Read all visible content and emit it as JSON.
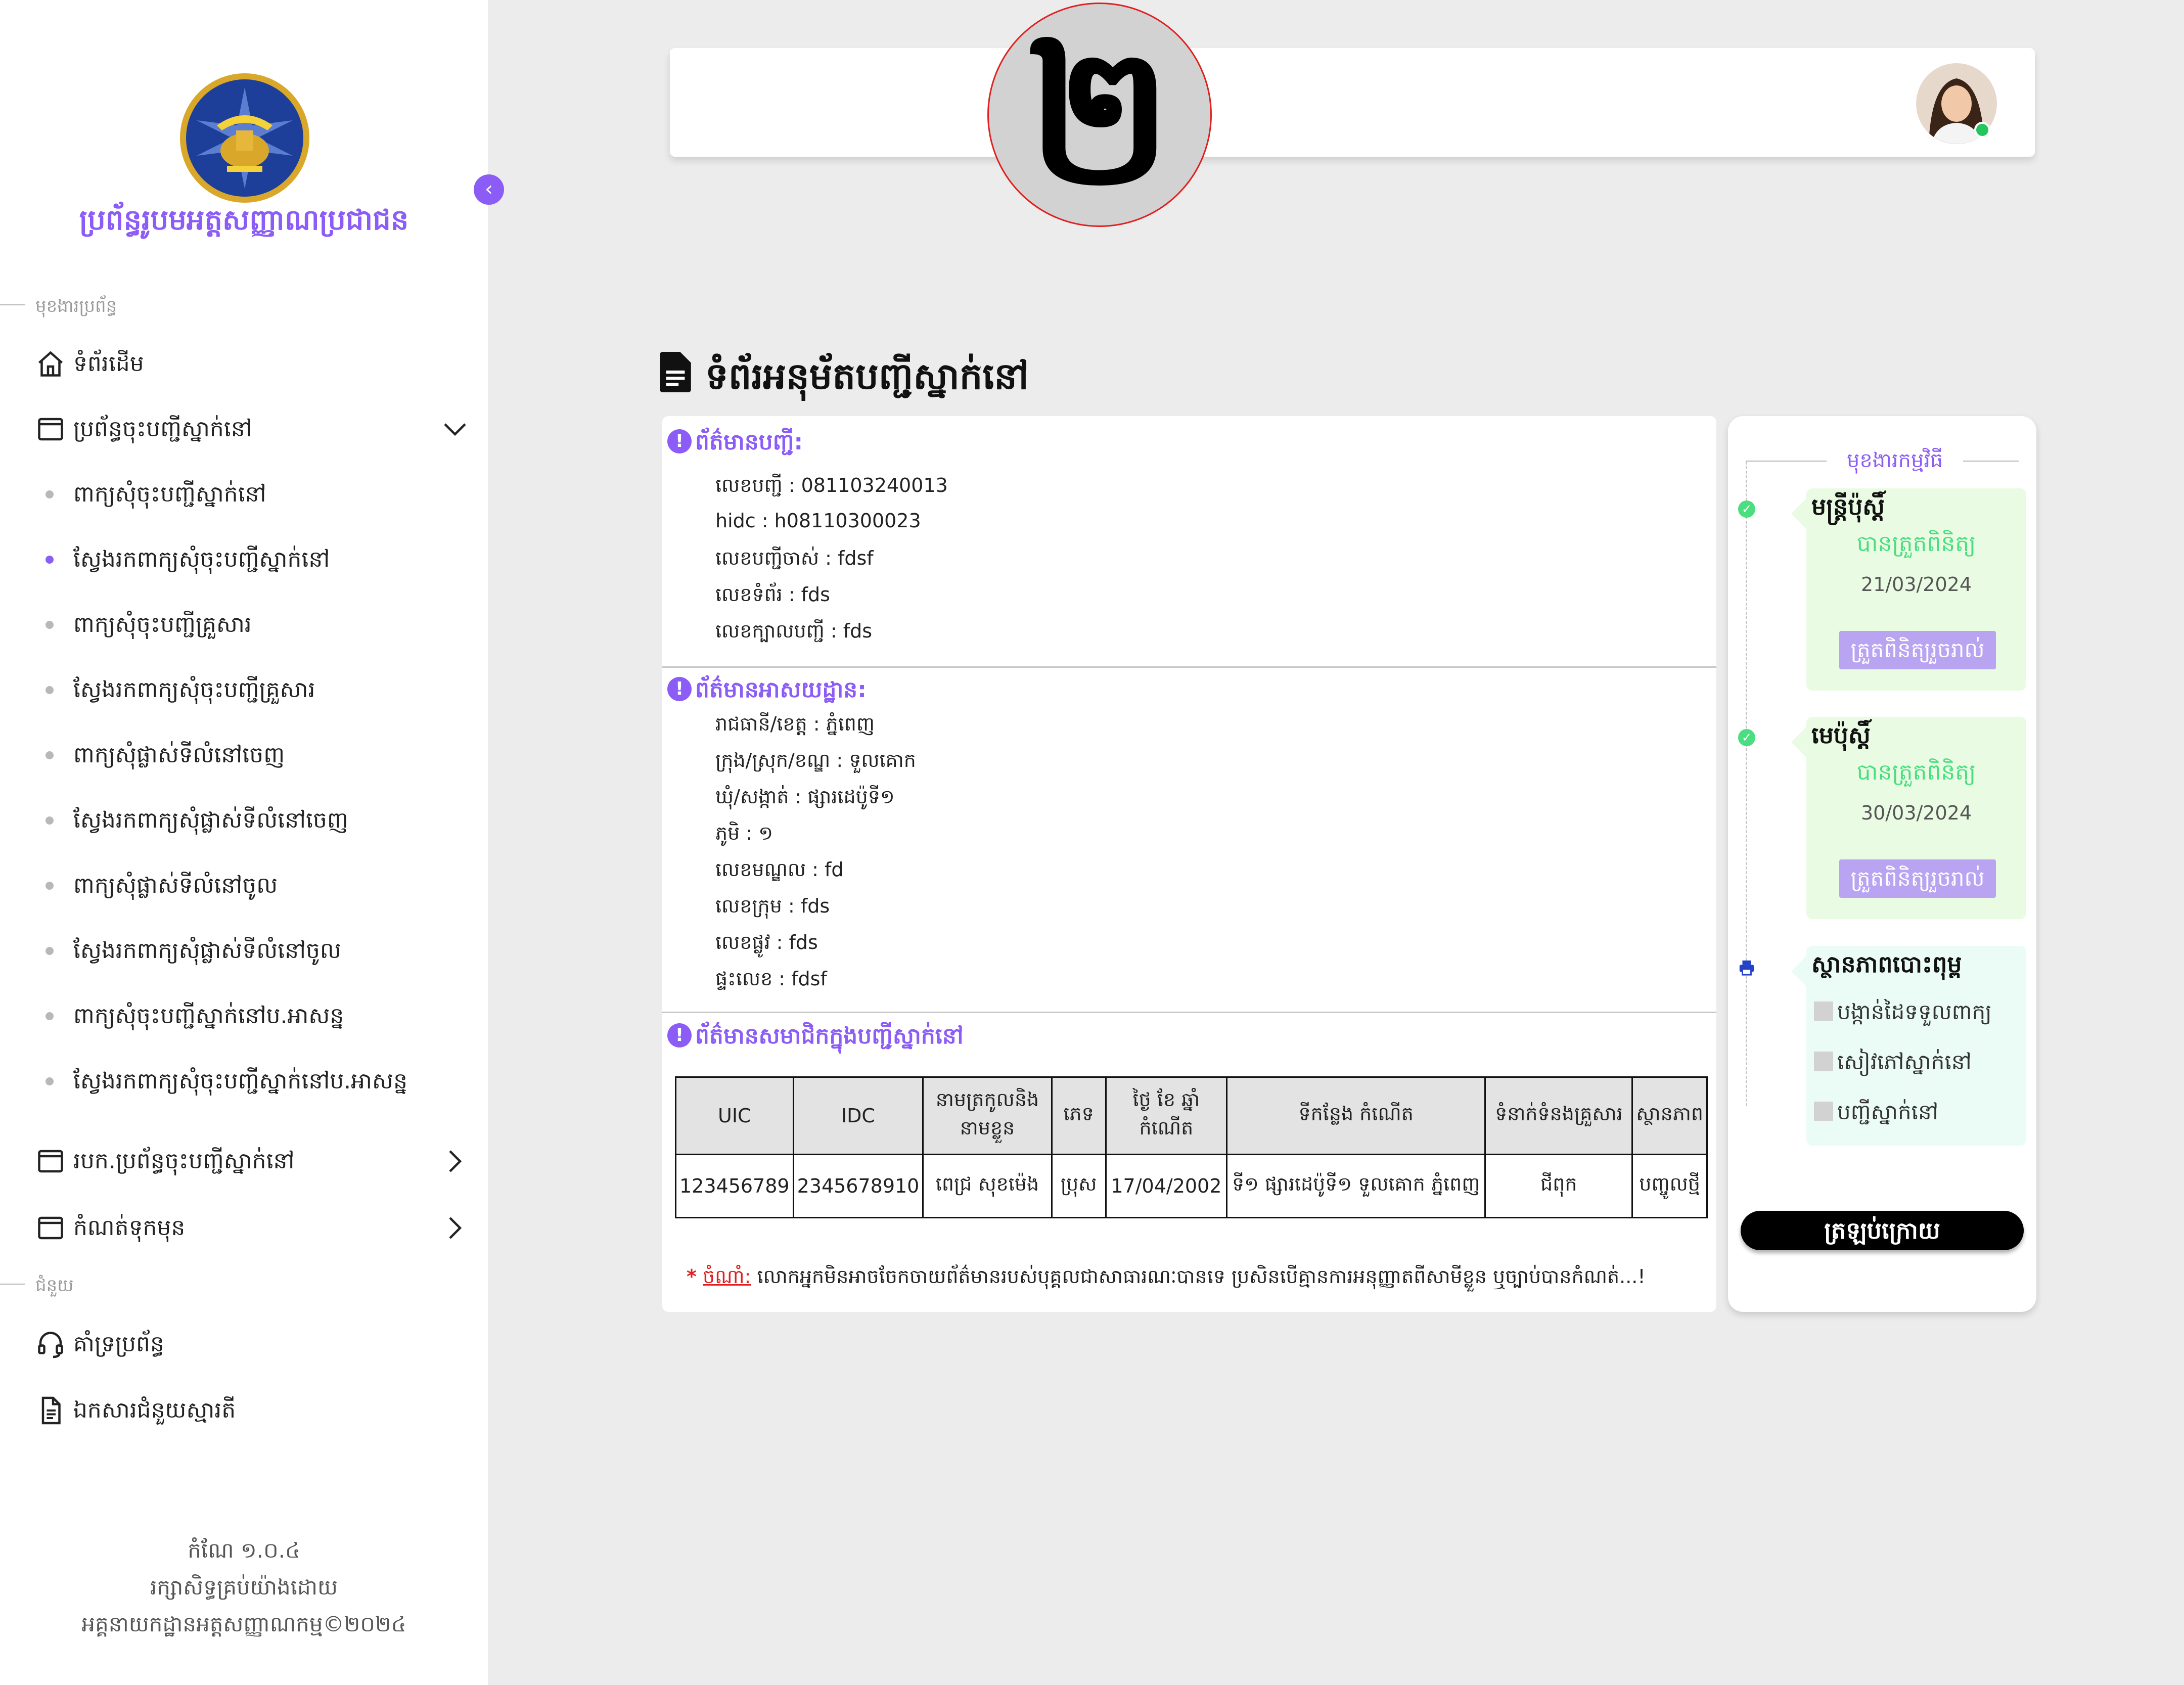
{
  "badge": "២",
  "sidebar": {
    "app_name": "ប្រព័ន្ធរូបមអត្តសញ្ញាណប្រជាជន",
    "section_main": "មុខងារប្រព័ន្ធ",
    "section_help": "ជំនួយ",
    "nav": {
      "home": "ទំព័រដើម",
      "residence_system": "ប្រព័ន្ធចុះបញ្ជីស្នាក់នៅ",
      "report": "របក.ប្រព័ន្ធចុះបញ្ជីស្នាក់នៅ",
      "drafts": "កំណត់ទុកមុន",
      "support": "គាំទ្រប្រព័ន្ធ",
      "guide": "ឯកសារជំនួយស្មារតី"
    },
    "sub_items": [
      "ពាក្យសុំចុះបញ្ជីស្នាក់នៅ",
      "ស្វែងរកពាក្យសុំចុះបញ្ជីស្នាក់នៅ",
      "ពាក្យសុំចុះបញ្ជីគ្រួសារ",
      "ស្វែងរកពាក្យសុំចុះបញ្ជីគ្រួសារ",
      "ពាក្យសុំផ្លាស់ទីលំនៅចេញ",
      "ស្វែងរកពាក្យសុំផ្លាស់ទីលំនៅចេញ",
      "ពាក្យសុំផ្លាស់ទីលំនៅចូល",
      "ស្វែងរកពាក្យសុំផ្លាស់ទីលំនៅចូល",
      "ពាក្យសុំចុះបញ្ជីស្នាក់នៅប.អាសន្ន",
      "ស្វែងរកពាក្យសុំចុះបញ្ជីស្នាក់នៅប.អាសន្ន"
    ],
    "active_sub_index": 1,
    "footer": {
      "version": "កំណែ ១.០.៤",
      "rights": "រក្សាសិទ្ធគ្រប់យ៉ាងដោយ",
      "org": "អគ្គនាយកដ្ឋានអត្តសញ្ញាណកម្ម©២០២៤"
    }
  },
  "page": {
    "title": "ទំព័រអនុម័តបញ្ជីស្នាក់នៅ",
    "registry": {
      "heading": "ព័ត៌មានបញ្ជី:",
      "fields": [
        "លេខបញ្ជី : 081103240013",
        "hidc : h08110300023",
        "លេខបញ្ជីចាស់ : fdsf",
        "លេខទំព័រ : fds",
        "លេខក្បាលបញ្ជី : fds"
      ]
    },
    "address": {
      "heading": "ព័ត៌មានអាសយដ្ឋាន:",
      "fields": [
        "រាជធានី/ខេត្ត : ភ្នំពេញ",
        "ក្រុង/ស្រុក/ខណ្ឌ : ទួលគោក",
        "ឃុំ/សង្កាត់ : ផ្សារដេប៉ូទី១",
        "ភូមិ : ១",
        "លេខមណ្ឌល : fd",
        "លេខក្រុម : fds",
        "លេខផ្លូវ : fds",
        "ផ្ទះលេខ : fdsf"
      ]
    },
    "members": {
      "heading": "ព័ត៌មានសមាជិកក្នុងបញ្ជីស្នាក់នៅ",
      "columns": [
        "UIC",
        "IDC",
        "នាមត្រកូលនិងនាមខ្លួន",
        "ភេទ",
        "ថ្ងៃ ខែ ឆ្នាំ កំណើត",
        "ទីកន្លែង កំណើត",
        "ទំនាក់ទំនងគ្រួសារ",
        "ស្ថានភាព"
      ],
      "rows": [
        [
          "123456789",
          "2345678910",
          "ពេជ្រ សុខម៉េង",
          "ប្រុស",
          "17/04/2002",
          "ទី១ ផ្សារដេប៉ូទី១ ទួលគោក ភ្នំពេញ",
          "ជីពុក",
          "បញ្ចូលថ្មី"
        ]
      ]
    },
    "note": {
      "star": "*",
      "label": "ចំណាំ:",
      "text": " លោកអ្នកមិនអាចចែកចាយព័ត៌មានរបស់បុគ្គលជាសាធារណៈបានទេ ប្រសិនបើគ្មានការអនុញ្ញាតពីសាមីខ្លួន ឬច្បាប់បានកំណត់...!"
    }
  },
  "workflow": {
    "heading": "មុខងារកម្មវិធី",
    "steps": [
      {
        "title": "មន្ត្រីប៉ុស្តិ៍",
        "status": "បានត្រួតពិនិត្យ",
        "date": "21/03/2024",
        "button": "ត្រួតពិនិត្យរួចរាល់"
      },
      {
        "title": "មេប៉ុស្តិ៍",
        "status": "បានត្រួតពិនិត្យ",
        "date": "30/03/2024",
        "button": "ត្រួតពិនិត្យរួចរាល់"
      }
    ],
    "print": {
      "title": "ស្ថានភាពបោះពុម្ព",
      "items": [
        "បង្កាន់ដៃទទួលពាក្យ",
        "សៀវភៅស្នាក់នៅ",
        "បញ្ជីស្នាក់នៅ"
      ]
    },
    "back": "ត្រឡប់ក្រោយ"
  },
  "colors": {
    "accent": "#8b5cf6",
    "success": "#4ade80",
    "step_bg": "#e9fbe2",
    "alert": "#e02020"
  }
}
